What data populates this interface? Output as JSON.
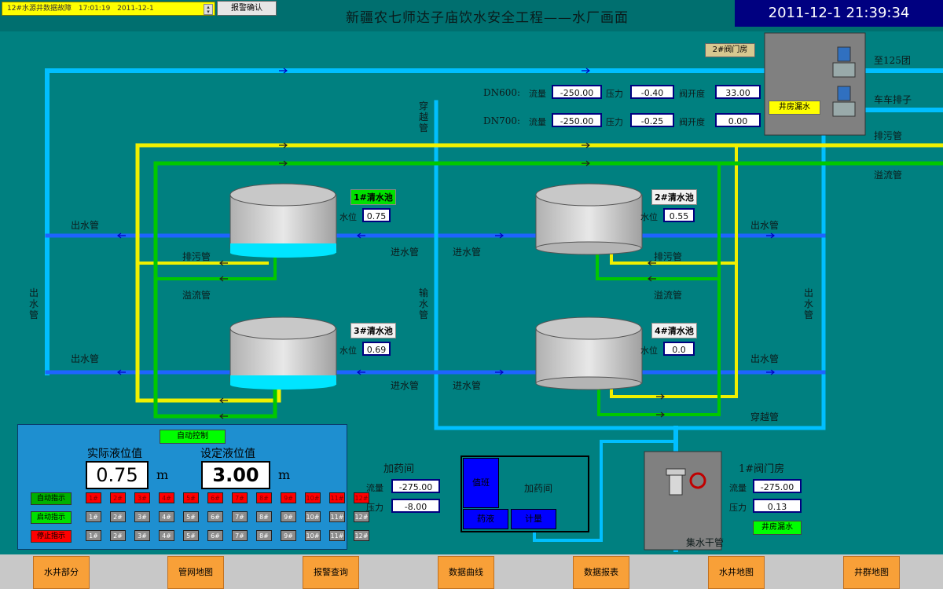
{
  "header": {
    "alarm_text": "12#水源井数据故障",
    "alarm_time": "17:01:19",
    "alarm_date": "2011-12-1",
    "ack_label": "报警确认",
    "title": "新疆农七师达子庙饮水安全工程——水厂画面",
    "clock": "2011-12-1 21:39:34"
  },
  "valve_room2": {
    "title": "2#阀门房",
    "leak_btn": "井房漏水",
    "to125": "至125团",
    "to_drain": "车车排子",
    "sewage": "排污管",
    "overflow": "溢流管"
  },
  "dn600": {
    "label": "DN600:",
    "flow_label": "流量",
    "flow": "-250.00",
    "press_label": "压力",
    "press": "-0.40",
    "valve_label": "阀开度",
    "valve": "33.00"
  },
  "dn700": {
    "label": "DN700:",
    "flow_label": "流量",
    "flow": "-250.00",
    "press_label": "压力",
    "press": "-0.25",
    "valve_label": "阀开度",
    "valve": "0.00"
  },
  "pipes": {
    "cross1": "穿越管",
    "cross2": "穿越管",
    "out_left_v": "出水管",
    "out_right_v": "出水管",
    "transfer": "输水管",
    "out_1": "出水管",
    "out_2": "出水管",
    "out_3": "出水管",
    "out_4": "出水管",
    "in_1": "进水管",
    "in_2": "进水管",
    "in_3": "进水管",
    "in_4": "进水管",
    "sew_1": "排污管",
    "sew_2": "排污管",
    "ovf_1": "溢流管",
    "ovf_2": "溢流管",
    "collector": "集水干管"
  },
  "tanks": {
    "t1": {
      "title": "1#清水池",
      "level_label": "水位",
      "level": "0.75"
    },
    "t2": {
      "title": "2#清水池",
      "level_label": "水位",
      "level": "0.55"
    },
    "t3": {
      "title": "3#清水池",
      "level_label": "水位",
      "level": "0.69"
    },
    "t4": {
      "title": "4#清水池",
      "level_label": "水位",
      "level": "0.0"
    }
  },
  "dosing": {
    "title": "加药间",
    "flow_label": "流量",
    "flow": "-275.00",
    "press_label": "压力",
    "press": "-8.00",
    "room_label": "加药间",
    "block_a": "值班",
    "block_b": "药液",
    "block_c": "计量"
  },
  "valve_room1": {
    "title": "1#阀门房",
    "flow_label": "流量",
    "flow": "-275.00",
    "press_label": "压力",
    "press": "0.13",
    "leak_btn": "井房漏水"
  },
  "control": {
    "mode_btn": "自动控制",
    "actual_label": "实际液位值",
    "set_label": "设定液位值",
    "actual": "0.75",
    "setpoint": "3.00",
    "unit": "m",
    "row_auto": "自动指示",
    "row_start": "启动指示",
    "row_stop": "停止指示",
    "wells": [
      "1#",
      "2#",
      "3#",
      "4#",
      "5#",
      "6#",
      "7#",
      "8#",
      "9#",
      "10#",
      "11#",
      "12#"
    ]
  },
  "nav": [
    "水井部分",
    "管网地图",
    "报警查询",
    "数据曲线",
    "数据报表",
    "水井地图",
    "井群地图"
  ],
  "colors": {
    "background": "#008080",
    "water_pipe": "#1e90ff",
    "sewage_pipe": "#ffff00",
    "overflow_pipe": "#00c000",
    "alarm": "#ff0000",
    "nav": "#f8a038"
  }
}
